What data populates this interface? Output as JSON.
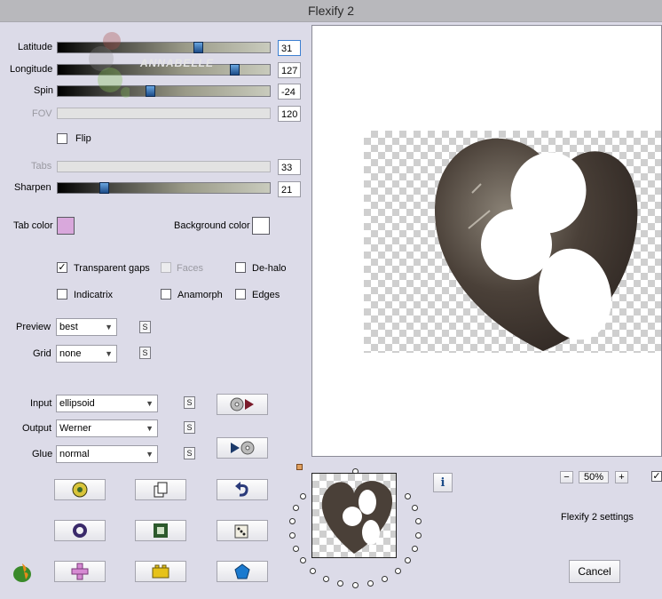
{
  "window": {
    "title": "Flexify 2"
  },
  "sliders": {
    "latitude": {
      "label": "Latitude",
      "value": "31"
    },
    "longitude": {
      "label": "Longitude",
      "value": "127"
    },
    "spin": {
      "label": "Spin",
      "value": "-24"
    },
    "fov": {
      "label": "FOV",
      "value": "120"
    },
    "tabs": {
      "label": "Tabs",
      "value": "33"
    },
    "sharpen": {
      "label": "Sharpen",
      "value": "21"
    }
  },
  "watermark": "ANNABELLE",
  "flip": {
    "label": "Flip"
  },
  "tab_color": {
    "label": "Tab color",
    "color": "#d9a8dc"
  },
  "background_color": {
    "label": "Background color",
    "color": "#ffffff"
  },
  "options": {
    "transparent_gaps": "Transparent gaps",
    "faces": "Faces",
    "dehalo": "De-halo",
    "indicatrix": "Indicatrix",
    "anamorph": "Anamorph",
    "edges": "Edges"
  },
  "preview": {
    "label": "Preview",
    "value": "best"
  },
  "grid": {
    "label": "Grid",
    "value": "none"
  },
  "input": {
    "label": "Input",
    "value": "ellipsoid"
  },
  "output": {
    "label": "Output",
    "value": "Werner"
  },
  "glue": {
    "label": "Glue",
    "value": "normal"
  },
  "s_label": "S",
  "zoom": {
    "value": "50%",
    "minus": "−",
    "plus": "+"
  },
  "settings_label": "Flexify 2 settings",
  "cancel_label": "Cancel",
  "colors": {
    "accent": "#3c7fd1",
    "heart": "#4a4038"
  }
}
